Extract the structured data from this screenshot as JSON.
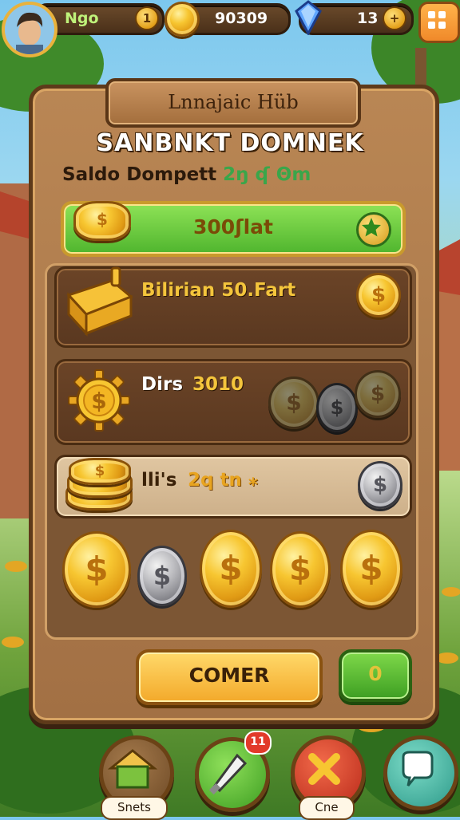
{
  "hud": {
    "player_name": "Ngo",
    "player_level": "1",
    "coin_total": "90309",
    "gem_total": "13"
  },
  "panel": {
    "title": "Lnnajaic Hüb",
    "headline": "SANBNKT DOMNEK",
    "subtitle": "Saldo Dompett",
    "subtitle_accent": "2ŋ ʠ Θm",
    "balance_label": "300ʃlat"
  },
  "rows": [
    {
      "label": "Bilirian 50.Fart",
      "icon": "treasure-chest-icon"
    },
    {
      "label_prefix": "Dirs",
      "label_value": "3010",
      "icon": "coin-gear-icon"
    },
    {
      "label_prefix": "lli's",
      "label_value": "2q tn ⁎",
      "icon": "coin-stack-icon"
    }
  ],
  "coin_glyph": "$",
  "actions": {
    "primary_label": "COMER",
    "count_label": "0"
  },
  "nav": {
    "home_label": "Snets",
    "notification_count": "11",
    "close_label": "Cne"
  },
  "colors": {
    "wood_panel": "#a27044",
    "gold_coin": "#f7c631",
    "green_bar": "#4fb52e",
    "action_gold": "#f3a92a"
  }
}
